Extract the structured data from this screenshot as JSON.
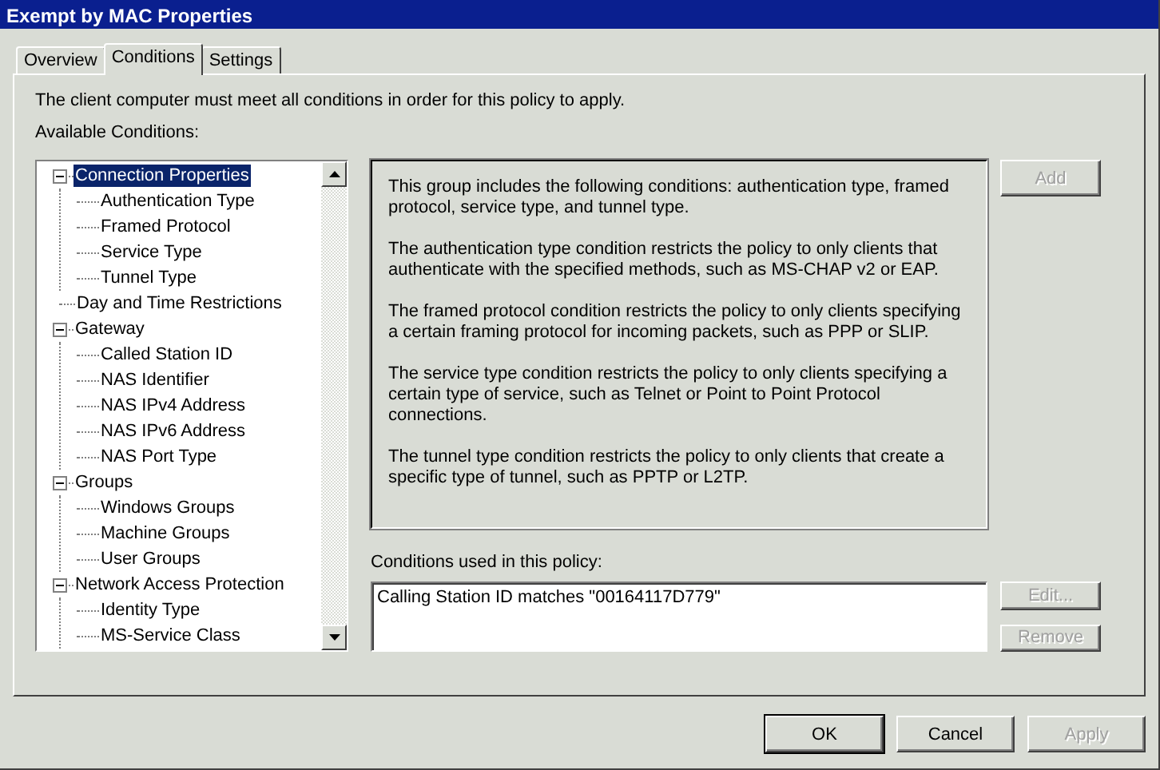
{
  "window": {
    "title": "Exempt by MAC Properties"
  },
  "tabs": [
    {
      "label": "Overview",
      "selected": false
    },
    {
      "label": "Conditions",
      "selected": true
    },
    {
      "label": "Settings",
      "selected": false
    }
  ],
  "intro": "The client computer must meet all conditions in order for this policy to apply.",
  "available_label": "Available Conditions:",
  "tree": [
    {
      "label": "Connection Properties",
      "selected": true,
      "expanded": true,
      "children": [
        {
          "label": "Authentication Type",
          "selected": false
        },
        {
          "label": "Framed Protocol",
          "selected": false
        },
        {
          "label": "Service Type",
          "selected": false
        },
        {
          "label": "Tunnel Type",
          "selected": false
        }
      ]
    },
    {
      "label": "Day and Time Restrictions",
      "selected": false
    },
    {
      "label": "Gateway",
      "selected": false,
      "expanded": true,
      "children": [
        {
          "label": "Called Station ID",
          "selected": false
        },
        {
          "label": "NAS Identifier",
          "selected": false
        },
        {
          "label": "NAS IPv4 Address",
          "selected": false
        },
        {
          "label": "NAS IPv6 Address",
          "selected": false
        },
        {
          "label": "NAS Port Type",
          "selected": false
        }
      ]
    },
    {
      "label": "Groups",
      "selected": false,
      "expanded": true,
      "children": [
        {
          "label": "Windows Groups",
          "selected": false
        },
        {
          "label": "Machine Groups",
          "selected": false
        },
        {
          "label": "User Groups",
          "selected": false
        }
      ]
    },
    {
      "label": "Network Access Protection",
      "selected": false,
      "expanded": true,
      "children": [
        {
          "label": "Identity Type",
          "selected": false
        },
        {
          "label": "MS-Service Class",
          "selected": false
        }
      ]
    }
  ],
  "description": [
    "This group includes the following conditions: authentication type, framed protocol, service type, and tunnel type.",
    "The authentication type condition restricts the policy to only clients that authenticate with the specified methods, such as MS-CHAP v2 or EAP.",
    "The framed protocol condition restricts the policy to only clients specifying a certain framing protocol for incoming packets, such as PPP or SLIP.",
    "The service type condition restricts the policy to only clients specifying a certain type of service, such as Telnet or Point to Point Protocol connections.",
    "The tunnel type condition restricts the policy to only clients that create a specific type of tunnel, such as PPTP or L2TP."
  ],
  "add_button": {
    "label": "Add",
    "disabled": true
  },
  "used_label": "Conditions used in this policy:",
  "used_conditions": [
    "Calling Station ID matches \"00164117D779\""
  ],
  "side_buttons": [
    {
      "label": "Edit...",
      "disabled": true
    },
    {
      "label": "Remove",
      "disabled": true
    }
  ],
  "footer_buttons": [
    {
      "label": "OK",
      "disabled": false,
      "default": true
    },
    {
      "label": "Cancel",
      "disabled": false,
      "default": false
    },
    {
      "label": "Apply",
      "disabled": true,
      "default": false
    }
  ]
}
